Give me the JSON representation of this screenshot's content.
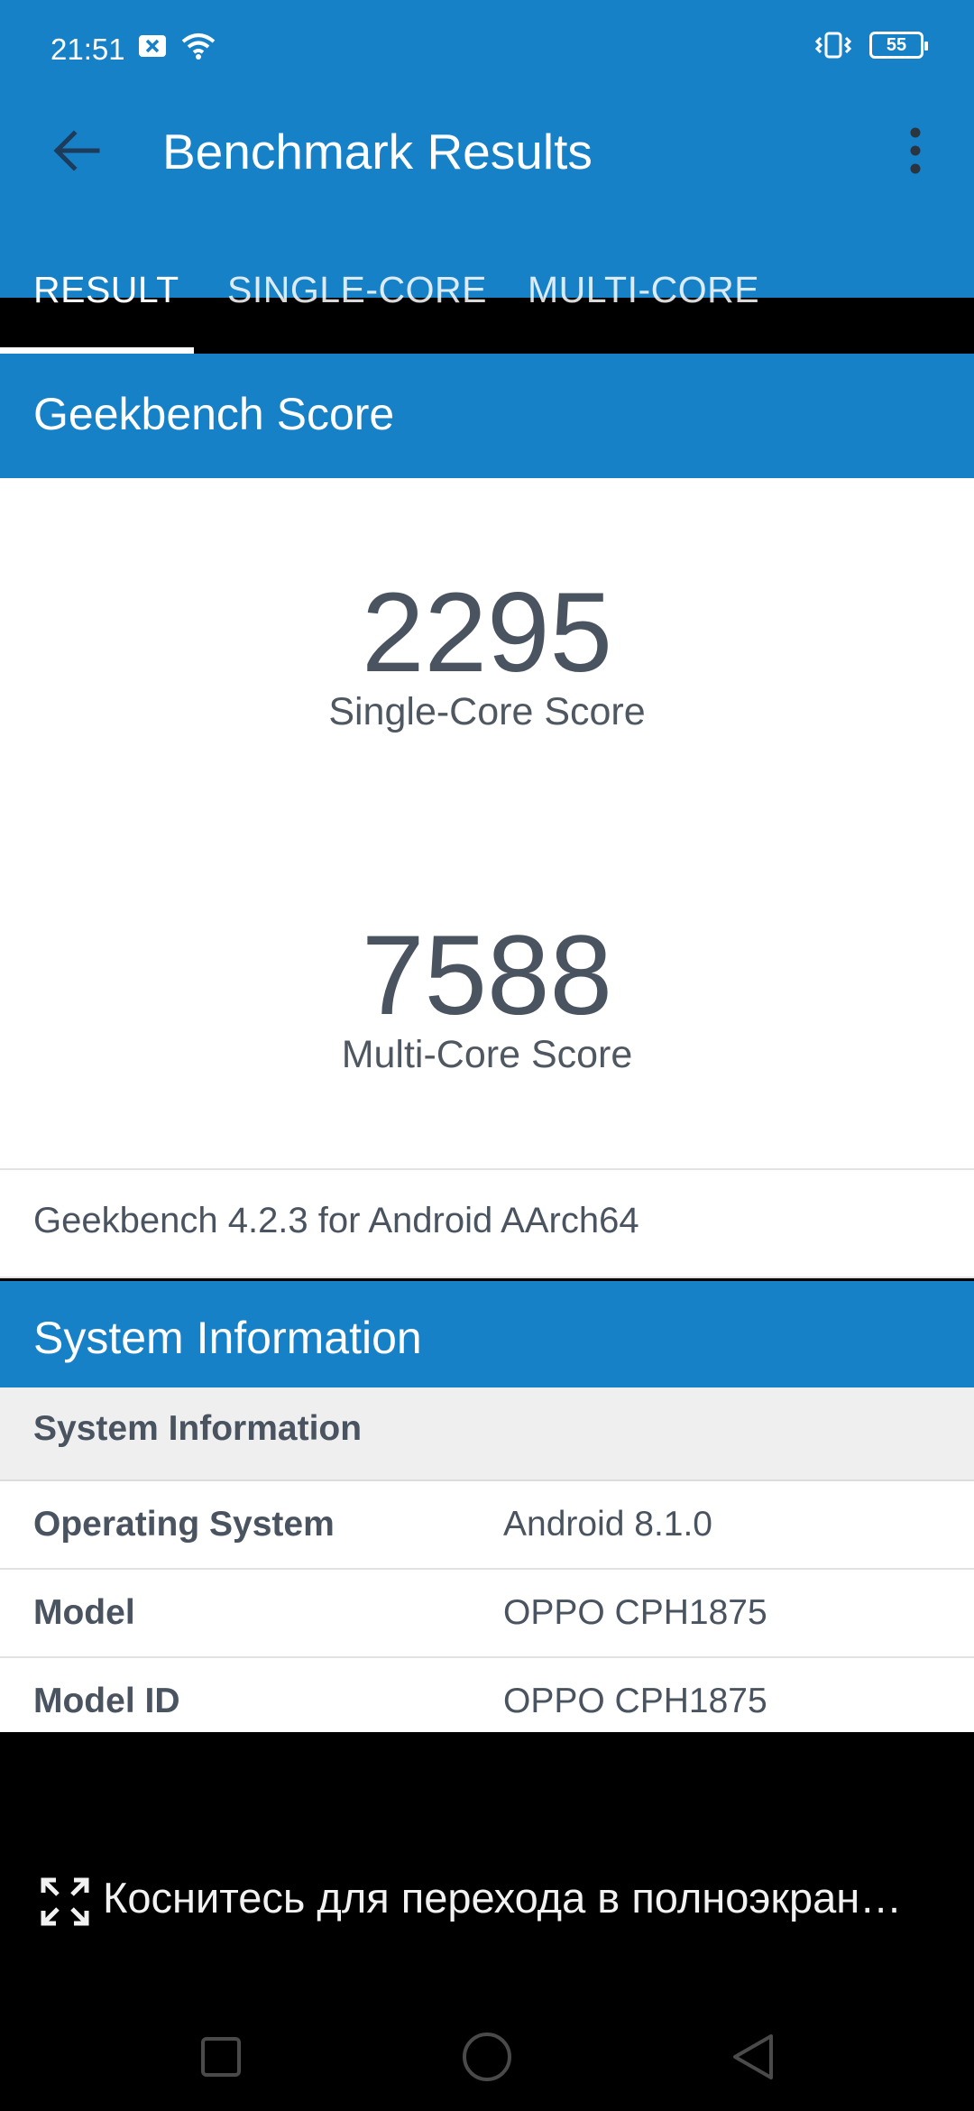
{
  "status_bar": {
    "time": "21:51",
    "battery": "55",
    "icons": [
      "notification-x-icon",
      "wifi-icon",
      "vibrate-icon",
      "battery-icon"
    ]
  },
  "app_bar": {
    "title": "Benchmark Results",
    "back_icon": "arrow-back-icon",
    "menu_icon": "more-vert-icon"
  },
  "tabs": [
    {
      "label": "RESULT",
      "selected": true
    },
    {
      "label": "SINGLE-CORE",
      "selected": false
    },
    {
      "label": "MULTI-CORE",
      "selected": false
    }
  ],
  "score_section": {
    "header": "Geekbench Score",
    "single_value": "2295",
    "single_label": "Single-Core Score",
    "multi_value": "7588",
    "multi_label": "Multi-Core Score",
    "version": "Geekbench 4.2.3 for Android AArch64"
  },
  "system_section": {
    "header": "System Information",
    "subheader": "System Information",
    "rows": [
      {
        "key": "Operating System",
        "value": "Android 8.1.0"
      },
      {
        "key": "Model",
        "value": "OPPO CPH1875"
      },
      {
        "key": "Model ID",
        "value": "OPPO CPH1875"
      }
    ]
  },
  "overlay": {
    "text": "Коснитесь для перехода в полноэкран…",
    "icon": "fullscreen-icon"
  },
  "nav_bar": {
    "icons": [
      "recent-apps-icon",
      "home-icon",
      "back-icon"
    ]
  },
  "colors": {
    "primary": "#1781c8",
    "text_dark": "#4a5360",
    "white": "#ffffff"
  }
}
